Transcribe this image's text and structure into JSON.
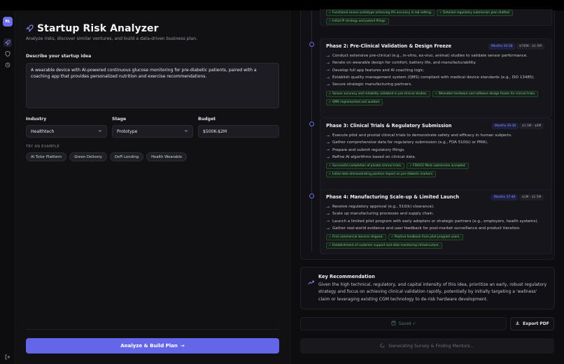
{
  "sidebar": {
    "avatar_initials": "RL",
    "icons": [
      "rocket-icon",
      "shield-icon",
      "history-icon",
      "logout-icon"
    ]
  },
  "form": {
    "title": "Startup Risk Analyzer",
    "subtitle": "Analyze risks, discover similar ventures, and build a data-driven business plan.",
    "idea_label": "Describe your startup idea",
    "idea_value": "A wearable device with AI-powered continuous glucose monitoring for pre-diabetic patients, paired with a coaching app that provides personalized nutrition and exercise recommendations.",
    "industry_label": "Industry",
    "industry_value": "Healthtech",
    "stage_label": "Stage",
    "stage_value": "Prototype",
    "budget_label": "Budget",
    "budget_value": "$500K-$2M",
    "examples_label": "TRY AN EXAMPLE",
    "examples": [
      "AI Tutor Platform",
      "Green Delivery",
      "DeFi Lending",
      "Health Wearable"
    ],
    "analyze_label": "Analyze & Build Plan",
    "accent_color": "#6466e8"
  },
  "plan": {
    "phase1_tail": {
      "milestones": [
        "✓ Functional sensor prototype achieving X% accuracy in lab setting.",
        "✓ Detailed regulatory submission plan drafted.",
        "✓ Initial IP strategy and patent filings."
      ]
    },
    "phases": [
      {
        "title": "Phase 2: Pre-Clinical Validation & Design Freeze",
        "months": "Months 10-18",
        "budget": "$700K - $1.5M",
        "actions": [
          "Conduct extensive pre-clinical (e.g., in-vitro, ex-vivo, animal) studies to validate sensor performance.",
          "Iterate on wearable design for comfort, battery life, and manufacturability.",
          "Develop full app features and AI coaching logic.",
          "Establish quality management system (QMS) compliant with medical device standards (e.g., ISO 13485).",
          "Secure strategic manufacturing partners."
        ],
        "milestones": [
          "✓ Sensor accuracy and reliability validated in pre-clinical studies.",
          "✓ Wearable hardware and software design frozen for clinical trials.",
          "✓ QMS implemented and audited."
        ]
      },
      {
        "title": "Phase 3: Clinical Trials & Regulatory Submission",
        "months": "Months 19-36",
        "budget": "$1.5M - $4M",
        "actions": [
          "Execute pilot and pivotal clinical trials to demonstrate safety and efficacy in human subjects.",
          "Gather comprehensive data for regulatory submission (e.g., FDA 510(k) or PMA).",
          "Prepare and submit regulatory filings.",
          "Refine AI algorithms based on clinical data."
        ],
        "milestones": [
          "✓ Successful completion of pivotal clinical trials.",
          "✓ FDA/CE Mark submission accepted.",
          "✓ Initial data demonstrating positive impact on pre-diabetic markers."
        ]
      },
      {
        "title": "Phase 4: Manufacturing Scale-up & Limited Launch",
        "months": "Months 37-48",
        "budget": "$1M - $2.5M",
        "actions": [
          "Receive regulatory approval (e.g., 510(k) clearance).",
          "Scale up manufacturing processes and supply chain.",
          "Launch a limited pilot program with early adopters or strategic partners (e.g., employers, health systems).",
          "Gather real-world evidence and user feedback for post-market surveillance and product iteration."
        ],
        "milestones": [
          "✓ First commercial devices shipped.",
          "✓ Positive feedback from pilot program users.",
          "✓ Establishment of customer support and data monitoring infrastructure."
        ]
      }
    ],
    "recommendation_title": "Key Recommendation",
    "recommendation_text": "Given the high technical, regulatory, and capital intensity of this idea, prioritize an early, robust regulatory strategy and focus on achieving clinical validation rapidly, potentially by initially targeting a 'wellness' claim or leveraging existing CGM technology to de-risk hardware development.",
    "saved_label": "Saved ✓",
    "export_label": "Export PDF",
    "generating_label": "Generating Survey & Finding Mentors..."
  }
}
